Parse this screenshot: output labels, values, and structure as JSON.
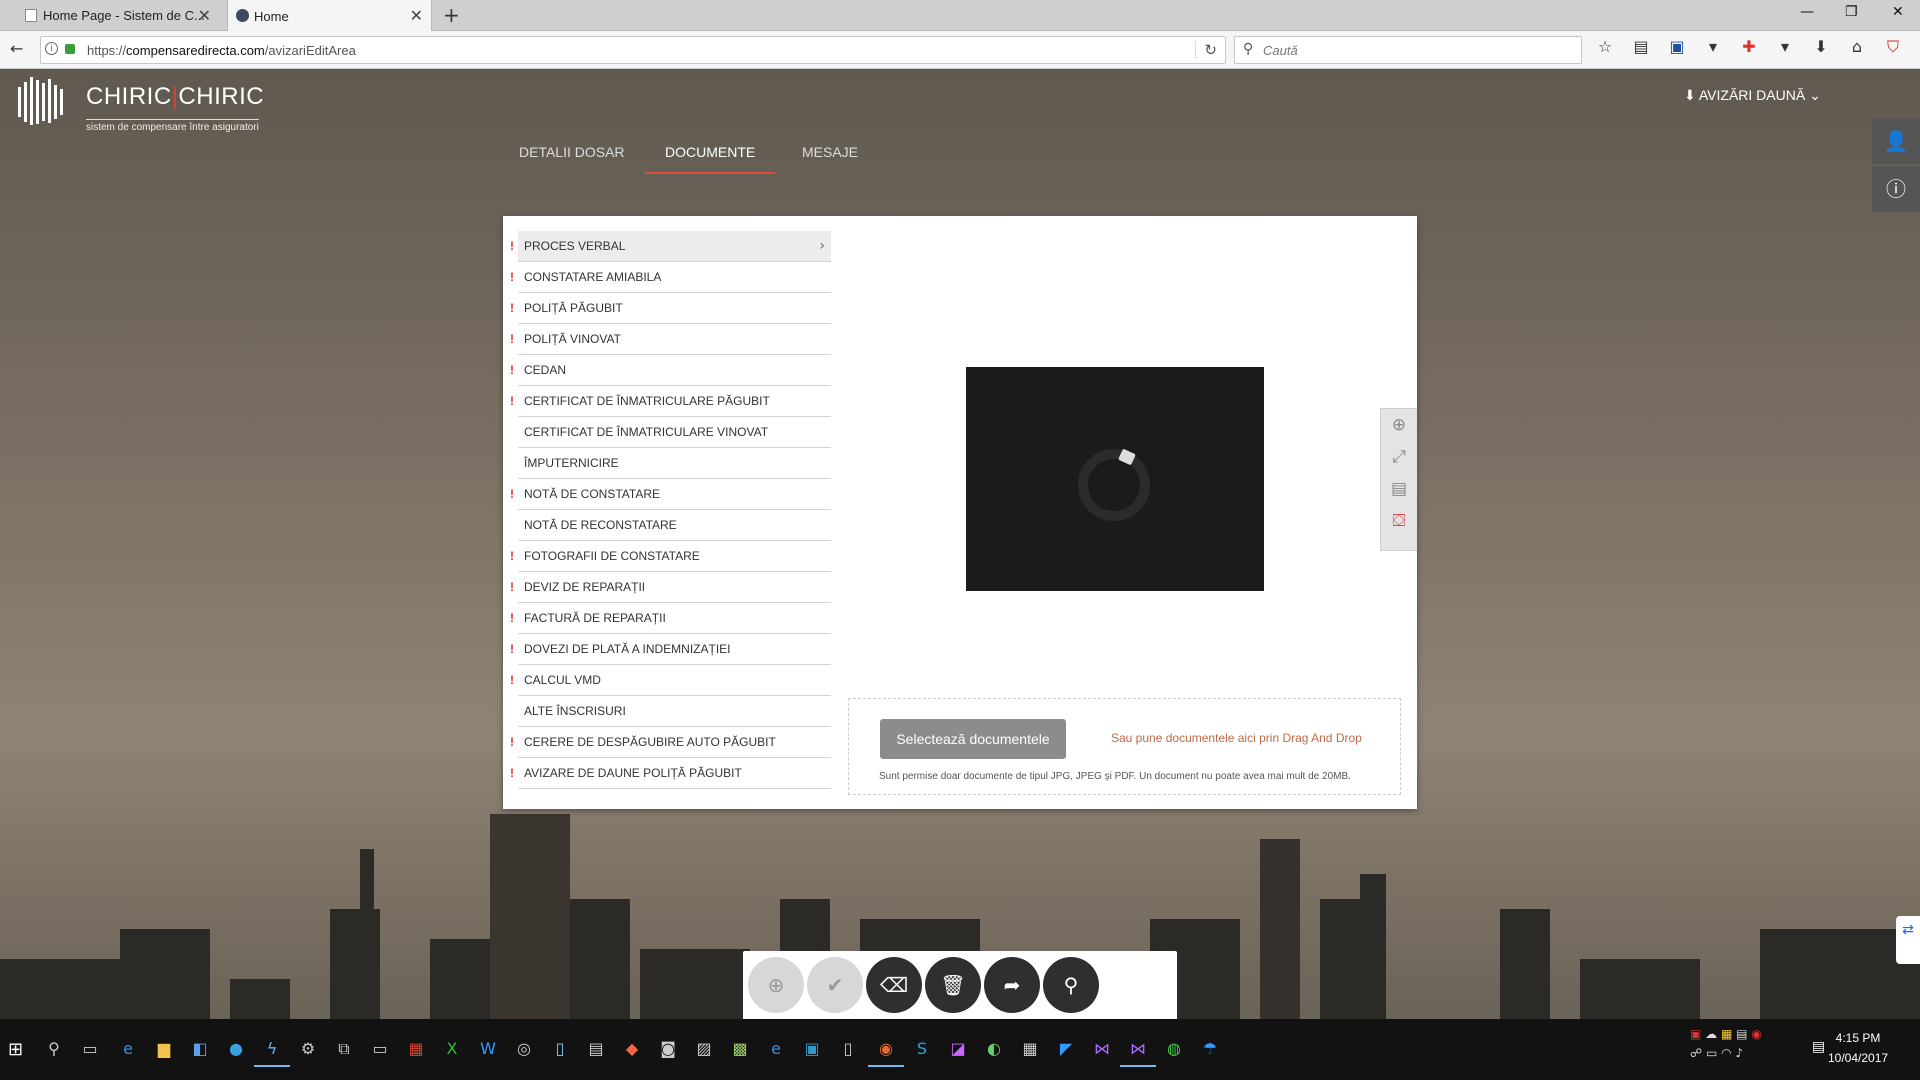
{
  "browser": {
    "tabs": [
      {
        "title": "Home Page - Sistem de C...",
        "active": false
      },
      {
        "title": "Home",
        "active": true
      }
    ],
    "url_prefix": "https://",
    "url_domain": "compensaredirecta.com",
    "url_path": "/avizariEditArea",
    "search_placeholder": "Caută"
  },
  "header": {
    "logo_left": "CHIRIC",
    "logo_sep": "|",
    "logo_right": "CHIRIC",
    "logo_subtitle": "sistem de compensare între asiguratori",
    "avizari_label": "AVIZĂRI DAUNĂ"
  },
  "nav_tabs": [
    {
      "label": "DETALII DOSAR",
      "active": false
    },
    {
      "label": "DOCUMENTE",
      "active": true
    },
    {
      "label": "MESAJE",
      "active": false
    }
  ],
  "documents": [
    {
      "label": "PROCES VERBAL",
      "required": true,
      "selected": true
    },
    {
      "label": "CONSTATARE AMIABILA",
      "required": true
    },
    {
      "label": "POLIȚĂ PĂGUBIT",
      "required": true
    },
    {
      "label": "POLIȚĂ VINOVAT",
      "required": true
    },
    {
      "label": "CEDAN",
      "required": true
    },
    {
      "label": "CERTIFICAT DE ÎNMATRICULARE PĂGUBIT",
      "required": true
    },
    {
      "label": "CERTIFICAT DE ÎNMATRICULARE VINOVAT",
      "required": false
    },
    {
      "label": "ÎMPUTERNICIRE",
      "required": false
    },
    {
      "label": "NOTĂ DE CONSTATARE",
      "required": true
    },
    {
      "label": "NOTĂ DE RECONSTATARE",
      "required": false
    },
    {
      "label": "FOTOGRAFII DE CONSTATARE",
      "required": true
    },
    {
      "label": "DEVIZ DE REPARAȚII",
      "required": true
    },
    {
      "label": "FACTURĂ DE REPARAȚII",
      "required": true
    },
    {
      "label": "DOVEZI DE PLATĂ A INDEMNIZAȚIEI",
      "required": true
    },
    {
      "label": "CALCUL VMD",
      "required": true
    },
    {
      "label": "ALTE ÎNSCRISURI",
      "required": false
    },
    {
      "label": "CERERE DE DESPĂGUBIRE AUTO PĂGUBIT",
      "required": true
    },
    {
      "label": "AVIZARE DE DAUNE POLIȚĂ PĂGUBIT",
      "required": true
    }
  ],
  "required_marker": "!",
  "upload": {
    "button_label": "Selectează documentele",
    "drag_text": "Sau pune documentele aici prin Drag And Drop",
    "note": "Sunt permise doar documente de tipul JPG, JPEG și PDF. Un document nu poate avea mai mult de 20MB."
  },
  "viewer_tools": [
    "add-icon",
    "expand-icon",
    "notes-icon",
    "delete-red-icon"
  ],
  "action_buttons": [
    {
      "name": "add-icon",
      "glyph": "⊕",
      "style": "light"
    },
    {
      "name": "check-icon",
      "glyph": "✔",
      "style": "light"
    },
    {
      "name": "eraser-icon",
      "glyph": "⌫",
      "style": "dark"
    },
    {
      "name": "trash-icon",
      "glyph": "🗑",
      "style": "dark"
    },
    {
      "name": "share-icon",
      "glyph": "➦",
      "style": "dark"
    },
    {
      "name": "search-icon",
      "glyph": "⚲",
      "style": "dark"
    }
  ],
  "taskbar": {
    "time": "4:15 PM",
    "date": "10/04/2017"
  },
  "colors": {
    "accent": "#e24a3b",
    "required": "#d9352a",
    "drag_text": "#c06a45"
  }
}
